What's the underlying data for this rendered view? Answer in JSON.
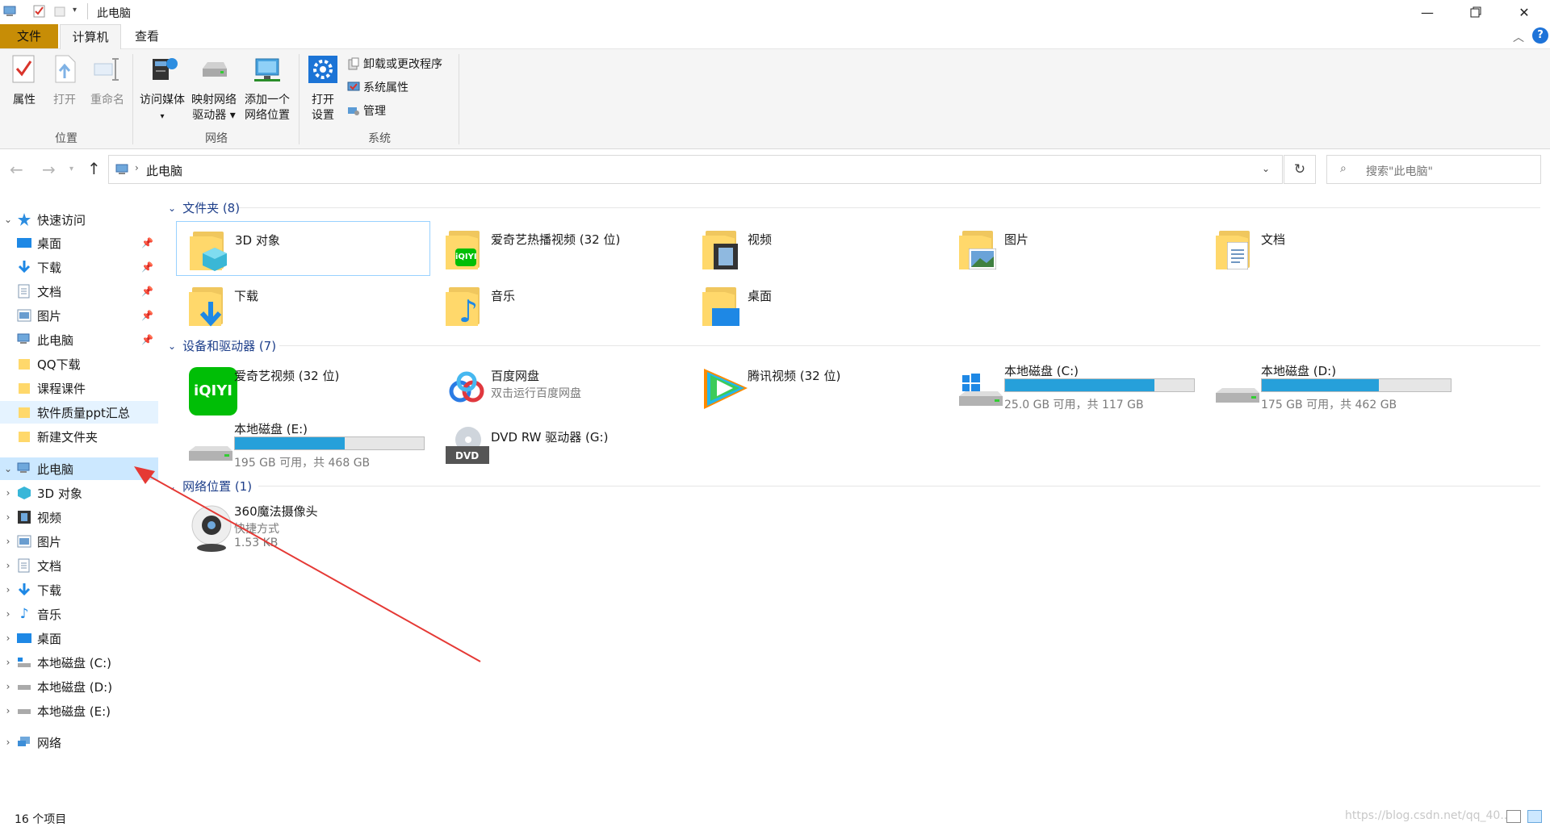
{
  "window": {
    "title": "此电脑"
  },
  "tabs": [
    {
      "label": "文件"
    },
    {
      "label": "计算机"
    },
    {
      "label": "查看"
    }
  ],
  "ribbon": {
    "location": {
      "label": "位置",
      "buttons": [
        {
          "label": "属性"
        },
        {
          "label": "打开"
        },
        {
          "label": "重命名"
        }
      ]
    },
    "network": {
      "label": "网络",
      "buttons": [
        {
          "line1": "访问媒体",
          "line2": ""
        },
        {
          "line1": "映射网络",
          "line2": "驱动器"
        },
        {
          "line1": "添加一个",
          "line2": "网络位置"
        }
      ]
    },
    "system": {
      "label": "系统",
      "open": {
        "line1": "打开",
        "line2": "设置"
      },
      "small": [
        {
          "label": "卸载或更改程序"
        },
        {
          "label": "系统属性"
        },
        {
          "label": "管理"
        }
      ]
    }
  },
  "address": {
    "path": "此电脑",
    "search_placeholder": "搜索\"此电脑\""
  },
  "nav": {
    "quick_access": "快速访问",
    "quick_items": [
      {
        "label": "桌面"
      },
      {
        "label": "下载"
      },
      {
        "label": "文档"
      },
      {
        "label": "图片"
      },
      {
        "label": "此电脑"
      },
      {
        "label": "QQ下载"
      },
      {
        "label": "课程课件"
      },
      {
        "label": "软件质量ppt汇总"
      },
      {
        "label": "新建文件夹"
      }
    ],
    "this_pc": "此电脑",
    "pc_items": [
      {
        "label": "3D 对象"
      },
      {
        "label": "视频"
      },
      {
        "label": "图片"
      },
      {
        "label": "文档"
      },
      {
        "label": "下载"
      },
      {
        "label": "音乐"
      },
      {
        "label": "桌面"
      },
      {
        "label": "本地磁盘 (C:)"
      },
      {
        "label": "本地磁盘 (D:)"
      },
      {
        "label": "本地磁盘 (E:)"
      }
    ],
    "network": "网络"
  },
  "sections": {
    "folders": {
      "header": "文件夹 (8)",
      "items": [
        {
          "name": "3D 对象"
        },
        {
          "name": "爱奇艺热播视频 (32 位)"
        },
        {
          "name": "视频"
        },
        {
          "name": "图片"
        },
        {
          "name": "文档"
        },
        {
          "name": "下载"
        },
        {
          "name": "音乐"
        },
        {
          "name": "桌面"
        }
      ]
    },
    "devices": {
      "header": "设备和驱动器 (7)",
      "items": [
        {
          "name": "爱奇艺视频 (32 位)",
          "sub": ""
        },
        {
          "name": "百度网盘",
          "sub": "双击运行百度网盘"
        },
        {
          "name": "腾讯视频 (32 位)",
          "sub": ""
        },
        {
          "name": "本地磁盘 (C:)",
          "sub": "25.0 GB 可用，共 117 GB",
          "usage": 0.79
        },
        {
          "name": "本地磁盘 (D:)",
          "sub": "175 GB 可用，共 462 GB",
          "usage": 0.62
        },
        {
          "name": "本地磁盘 (E:)",
          "sub": "195 GB 可用，共 468 GB",
          "usage": 0.58
        },
        {
          "name": "DVD RW 驱动器 (G:)",
          "sub": ""
        }
      ]
    },
    "network": {
      "header": "网络位置 (1)",
      "items": [
        {
          "name": "360魔法摄像头",
          "sub": "快捷方式",
          "size": "1.53 KB"
        }
      ]
    }
  },
  "status": {
    "count": "16 个项目"
  },
  "watermark": "https://blog.csdn.net/qq_40...",
  "colors": {
    "file_tab": "#c78d06",
    "accent": "#26a0da",
    "arrow": "#e53935",
    "section_header": "#1e3f8a"
  }
}
